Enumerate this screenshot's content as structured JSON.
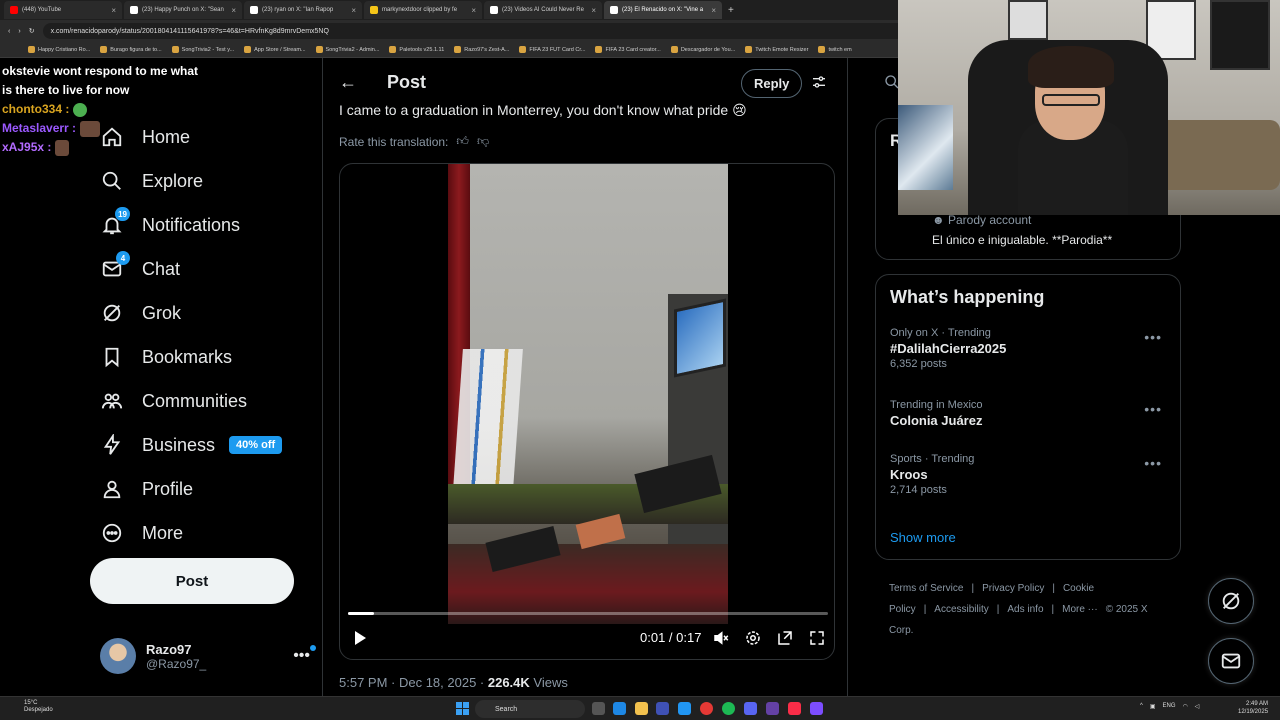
{
  "browser": {
    "tabs": [
      {
        "label": "(448) YouTube",
        "color": "#ff0000",
        "active": false
      },
      {
        "label": "(23) Happy Punch on X: \"Sean",
        "color": "#ffffff",
        "active": false
      },
      {
        "label": "(23) ryan on X: \"Ian Rapop",
        "color": "#ffffff",
        "active": false
      },
      {
        "label": "markynextdoor clipped by fe",
        "color": "#f5c518",
        "active": false
      },
      {
        "label": "(23) Videos AI Could Never Re",
        "color": "#ffffff",
        "active": false
      },
      {
        "label": "(23) El Renacido on X: \"Vine a",
        "color": "#ffffff",
        "active": true
      }
    ],
    "url": "x.com/renacidoparody/status/2001804141115641978?s=46&t=HRvfnKg8d9mrvDemx5NQ",
    "bookmarks": [
      "Happy Cristiano Ro...",
      "Burago figura de to...",
      "SongTrivia2 - Test y...",
      "App Store / Stream...",
      "SongTrivia2 - Admin...",
      "Paletools v25.1.11",
      "Razo97's Zest-A...",
      "FIFA 23 FUT Card Cr...",
      "FIFA 23 Card creator...",
      "Descargador de You...",
      "Twitch Emote Resizer",
      "twitch em"
    ]
  },
  "chat": [
    {
      "user": "okstevie",
      "color": "#ffffff",
      "message": "okstevie wont respond to me what is there to live for now",
      "line1": "okstevie wont respond to me what",
      "line2": "is there to live for now"
    },
    {
      "user": "chonto334",
      "color": "#daa520",
      "message": "chonto334 :"
    },
    {
      "user": "Metaslaverr",
      "color": "#9b59ff",
      "message": "Metaslaverr :"
    },
    {
      "user": "xAJ95x",
      "color": "#b36bff",
      "message": "xAJ95x :"
    }
  ],
  "nav": {
    "items": [
      {
        "label": "Home",
        "icon": "home-icon"
      },
      {
        "label": "Explore",
        "icon": "search-icon"
      },
      {
        "label": "Notifications",
        "icon": "bell-icon",
        "badge": "19"
      },
      {
        "label": "Chat",
        "icon": "mail-icon",
        "badge": "4"
      },
      {
        "label": "Grok",
        "icon": "grok-icon"
      },
      {
        "label": "Bookmarks",
        "icon": "bookmark-icon"
      },
      {
        "label": "Communities",
        "icon": "people-icon"
      },
      {
        "label": "Business",
        "icon": "lightning-icon",
        "pill": "40% off"
      },
      {
        "label": "Profile",
        "icon": "person-icon"
      },
      {
        "label": "More",
        "icon": "more-circle-icon"
      }
    ],
    "post_button": "Post",
    "account": {
      "name": "Razo97",
      "handle": "@Razo97_",
      "more": "•••"
    }
  },
  "post": {
    "back": "←",
    "title": "Post",
    "reply": "Reply",
    "text": "I came to a graduation in Monterrey, you don't know what pride 😢",
    "rate_translation": "Rate this translation:",
    "video": {
      "progress": 0.055,
      "current": "0:01",
      "duration": "0:17",
      "time_display": "0:01 / 0:17"
    },
    "time": "5:57 PM · Dec 18, 2025 · ",
    "views_count": "226.4K",
    "views_label": " Views"
  },
  "right": {
    "parody_letter": "R",
    "parody_label": "Parody account",
    "parody_bio": "El único e inigualable. **Parodia**",
    "happening_title": "What’s happening",
    "trends": [
      {
        "context": "Only on X · Trending",
        "topic": "#DalilahCierra2025",
        "count": "6,352 posts"
      },
      {
        "context": "Trending in Mexico",
        "topic": "Colonia Juárez",
        "count": ""
      },
      {
        "context": "Sports · Trending",
        "topic": "Kroos",
        "count": "2,714 posts"
      }
    ],
    "trend_menu": "•••",
    "show_more": "Show more",
    "footer": [
      "Terms of Service",
      "|",
      "Privacy Policy",
      "|",
      "Cookie Policy",
      "|",
      "Accessibility",
      "|",
      "Ads info",
      "|",
      "More ···",
      "© 2025 X Corp."
    ]
  },
  "taskbar": {
    "weather_temp": "15°C",
    "weather_desc": "Despejado",
    "search": "Search",
    "lang": "ENG",
    "time": "2:49 AM",
    "date": "12/19/2025"
  },
  "colors": {
    "accent": "#1d9bf0",
    "background": "#000000",
    "border": "#2f3336",
    "muted": "#8b98a5"
  }
}
